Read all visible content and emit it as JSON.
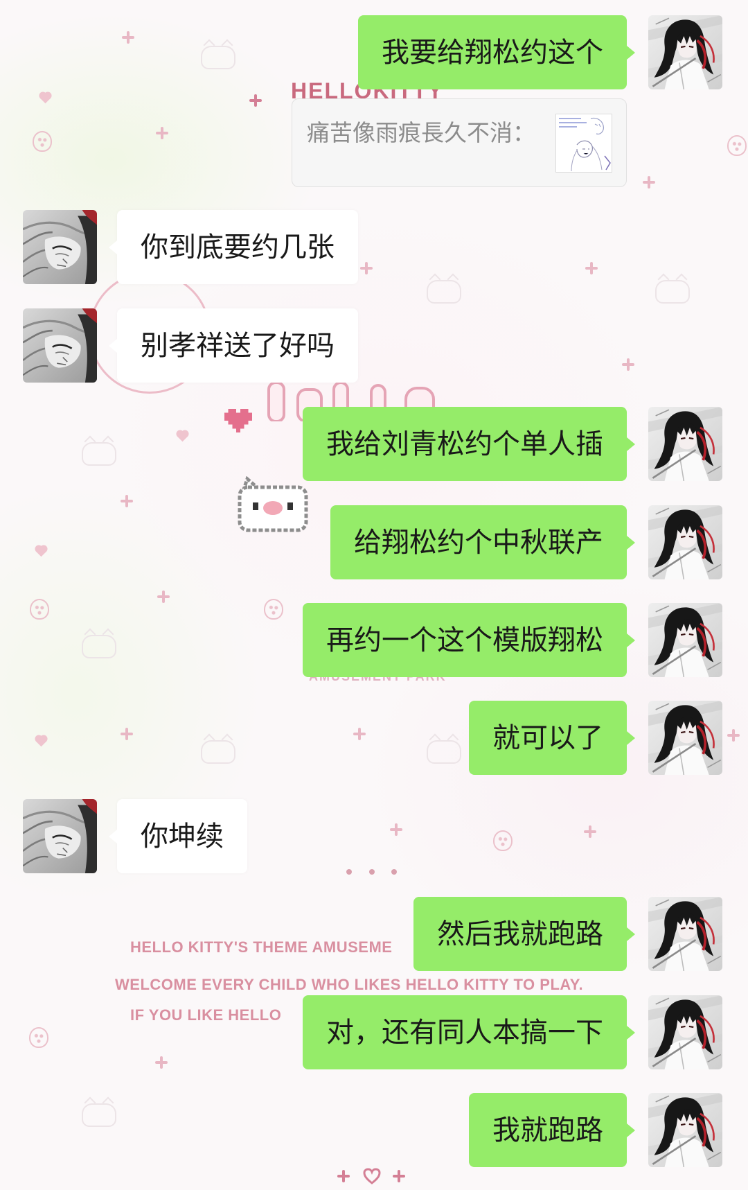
{
  "colors": {
    "sent_bubble": "#95ec69",
    "received_bubble": "#ffffff",
    "message_text": "#191919",
    "quote_text": "#8c8c8c",
    "wallpaper_pink": "#d98fa0"
  },
  "icons": {
    "my_avatar": "anime-girl-portrait-icon",
    "their_avatar": "sketch-portrait-icon",
    "quote_thumbnail": "sketch-image-thumbnail-icon"
  },
  "wallpaper": {
    "logo": "HELLOKITTY",
    "park_label": "AMUSEMENT PARK",
    "line_1": "HELLO KITTY'S THEME AMUSEME",
    "line_2": "WELCOME EVERY CHILD WHO LIKES HELLO KITTY TO PLAY.",
    "line_3": "IF YOU LIKE HELLO"
  },
  "messages": [
    {
      "from_me": true,
      "text": "我要给翔松约这个",
      "quote": "痛苦像雨痕長久不消："
    },
    {
      "from_me": false,
      "text": "你到底要约几张"
    },
    {
      "from_me": false,
      "text": "别孝祥送了好吗"
    },
    {
      "from_me": true,
      "text": "我给刘青松约个单人插"
    },
    {
      "from_me": true,
      "text": "给翔松约个中秋联产"
    },
    {
      "from_me": true,
      "text": "再约一个这个模版翔松"
    },
    {
      "from_me": true,
      "text": "就可以了"
    },
    {
      "from_me": false,
      "text": "你坤续"
    },
    {
      "from_me": true,
      "text": "然后我就跑路"
    },
    {
      "from_me": true,
      "text": "对，还有同人本搞一下"
    },
    {
      "from_me": true,
      "text": "我就跑路"
    }
  ]
}
